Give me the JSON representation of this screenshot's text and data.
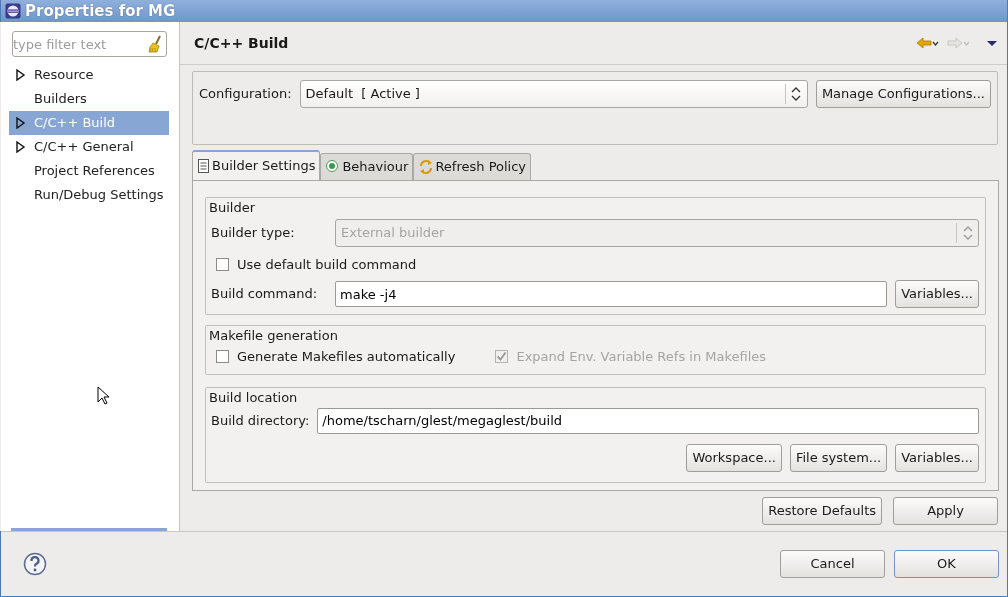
{
  "window": {
    "title": "Properties for MG"
  },
  "sidebar": {
    "filter": {
      "placeholder": "type filter text"
    },
    "items": [
      {
        "label": "Resource",
        "expandable": true,
        "selected": false
      },
      {
        "label": "Builders",
        "expandable": false,
        "selected": false
      },
      {
        "label": "C/C++ Build",
        "expandable": true,
        "selected": true
      },
      {
        "label": "C/C++ General",
        "expandable": true,
        "selected": false
      },
      {
        "label": "Project References",
        "expandable": false,
        "selected": false
      },
      {
        "label": "Run/Debug Settings",
        "expandable": false,
        "selected": false
      }
    ]
  },
  "page": {
    "title": "C/C++ Build",
    "back_enabled": true,
    "forward_enabled": false
  },
  "configuration": {
    "label": "Configuration:",
    "value": "Default  [ Active ]",
    "button": "Manage Configurations..."
  },
  "tabs": [
    {
      "label": "Builder Settings",
      "kind": "list",
      "selected": true
    },
    {
      "label": "Behaviour",
      "kind": "radio",
      "selected": false
    },
    {
      "label": "Refresh Policy",
      "kind": "refresh",
      "selected": false
    }
  ],
  "builder": {
    "title": "Builder",
    "type_label": "Builder type:",
    "type_value": "External builder",
    "type_disabled": true,
    "use_default": {
      "label": "Use default build command",
      "checked": false,
      "disabled": false
    },
    "command_label": "Build command:",
    "command_value": "make -j4",
    "variables": "Variables..."
  },
  "makefile": {
    "title": "Makefile generation",
    "options": [
      {
        "label": "Generate Makefiles automatically",
        "checked": false,
        "disabled": false
      },
      {
        "label": "Expand Env. Variable Refs in Makefiles",
        "checked": true,
        "disabled": true
      }
    ]
  },
  "location": {
    "title": "Build location",
    "directory_label": "Build directory:",
    "directory_value": "/home/tscharn/glest/megaglest/build",
    "buttons": [
      "Workspace...",
      "File system...",
      "Variables..."
    ]
  },
  "page_buttons": [
    {
      "label": "Restore Defaults"
    },
    {
      "label": "Apply"
    }
  ],
  "dialog_buttons": [
    {
      "label": "Cancel",
      "default": false
    },
    {
      "label": "OK",
      "default": true
    }
  ]
}
